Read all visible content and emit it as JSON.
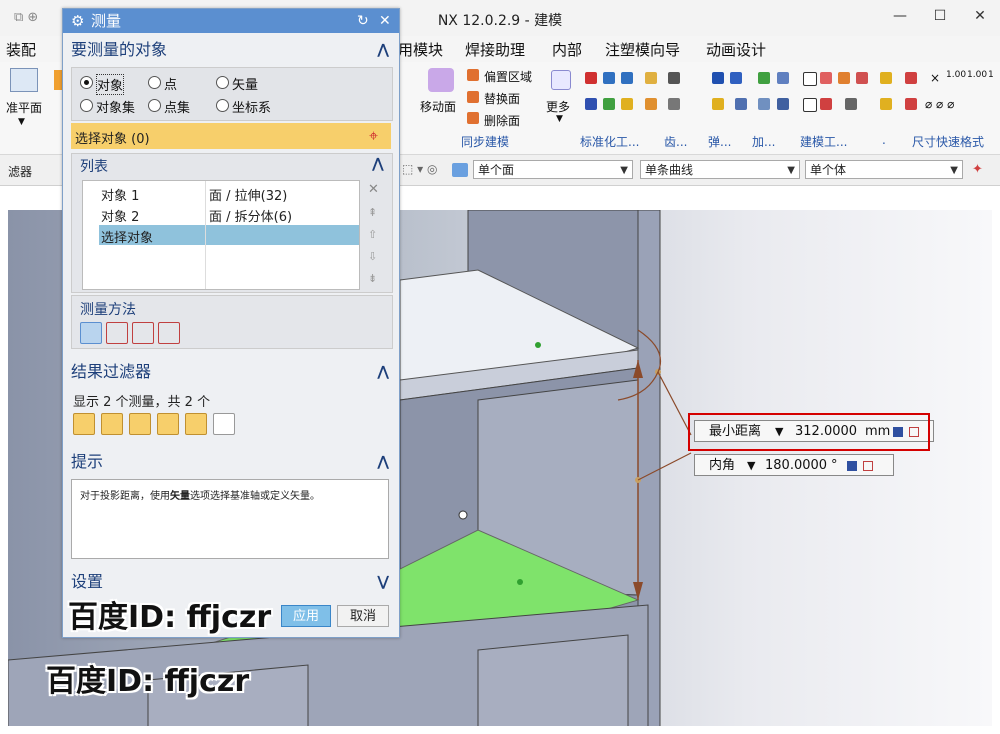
{
  "window": {
    "title": "NX 12.0.2.9 - 建模"
  },
  "menubar": {
    "items": [
      "装配",
      "用模块",
      "焊接助理",
      "内部",
      "注塑模向导",
      "动画设计"
    ]
  },
  "ribbon": {
    "datum_label": "准平面",
    "sync": {
      "move_face": "移动面",
      "offset_region": "偏置区域",
      "replace_face": "替换面",
      "delete_face": "删除面",
      "more": "更多",
      "group_label": "同步建模"
    },
    "group_labels": [
      "标准化工...",
      "齿...",
      "弹...",
      "加...",
      "建模工...",
      ".",
      "尺寸快速格式"
    ]
  },
  "filterbar": {
    "left_label": "滤器",
    "face_rule": "单个面",
    "curve_rule": "单条曲线",
    "body_rule": "单个体"
  },
  "dialog": {
    "title": "测量",
    "section_objects": "要测量的对象",
    "radio_options": [
      "对象",
      "点",
      "矢量",
      "对象集",
      "点集",
      "坐标系"
    ],
    "selected_radio": "对象",
    "select_label": "选择对象 (0)",
    "list_header": "列表",
    "list_rows": [
      {
        "name": "对象 1",
        "value": "面 / 拉伸(32)"
      },
      {
        "name": "对象 2",
        "value": "面 / 拆分体(6)"
      },
      {
        "name": "选择对象",
        "value": ""
      }
    ],
    "method_label": "测量方法",
    "section_filter": "结果过滤器",
    "filter_summary": "显示 2 个测量，共 2 个",
    "section_hint": "提示",
    "hint_prefix": "对于投影距离，使用",
    "hint_bold": "矢量",
    "hint_suffix": "选项选择基准轴或定义矢量。",
    "section_settings": "设置",
    "apply": "应用",
    "cancel": "取消"
  },
  "measurement": {
    "min_distance_label": "最小距离",
    "min_distance_value": "312.0000",
    "min_distance_unit": "mm",
    "angle_label": "内角",
    "angle_value": "180.0000",
    "angle_unit": "°"
  },
  "watermark": {
    "text1": "百度ID: ffjczr",
    "text2": "百度ID: ffjczr"
  },
  "colors": {
    "dialog_title": "#5b8fd0",
    "select_highlight": "#f7cf6b",
    "highlight_red": "#d40000",
    "green_face": "#7fe36b"
  }
}
